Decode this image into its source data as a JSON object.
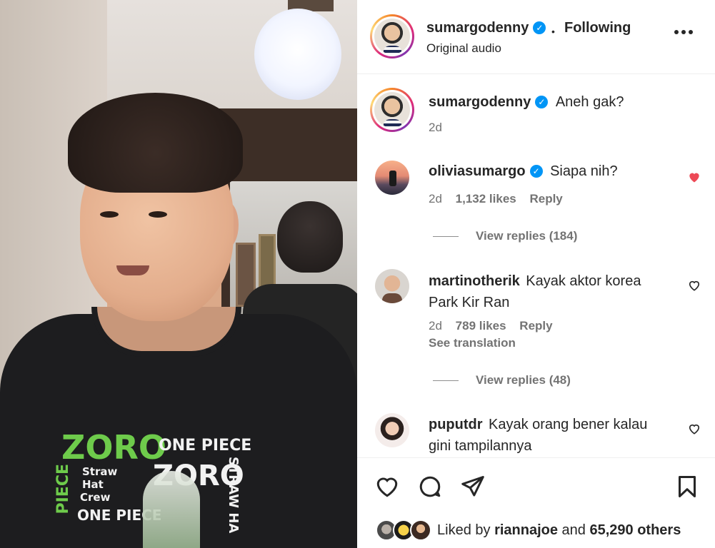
{
  "post": {
    "author": "sumargodenny",
    "follow_status": "Following",
    "separator": "•",
    "audio": "Original audio",
    "more_icon": "more-horizontal-icon",
    "caption_author": "sumargodenny",
    "caption_text": "Aneh gak?",
    "caption_time": "2d"
  },
  "media": {
    "shirt_print": [
      "ZORO",
      "ONE PIECE",
      "Straw",
      "Hat",
      "Crew",
      "ZORO",
      "ONE PIECE",
      "STRAW HA",
      "PIECE"
    ]
  },
  "comments": [
    {
      "user": "oliviasumargo",
      "verified": true,
      "text": "Siapa nih?",
      "time": "2d",
      "likes": "1,132 likes",
      "reply": "Reply",
      "liked": true,
      "view_replies": "View replies (184)"
    },
    {
      "user": "martinotherik",
      "verified": false,
      "text": "Kayak aktor korea",
      "text2": "Park Kir Ran",
      "time": "2d",
      "likes": "789 likes",
      "reply": "Reply",
      "see_translation": "See translation",
      "liked": false,
      "view_replies": "View replies (48)"
    },
    {
      "user": "puputdr",
      "verified": false,
      "text": "Kayak orang bener kalau",
      "text2": "gini tampilannya",
      "liked": false
    }
  ],
  "likes": {
    "prefix": "Liked by",
    "user": "riannajoe",
    "and": "and",
    "others": "65,290 others"
  },
  "colors": {
    "liked_heart": "#ed4956",
    "verified": "#0095f6",
    "secondary_text": "#737373"
  }
}
